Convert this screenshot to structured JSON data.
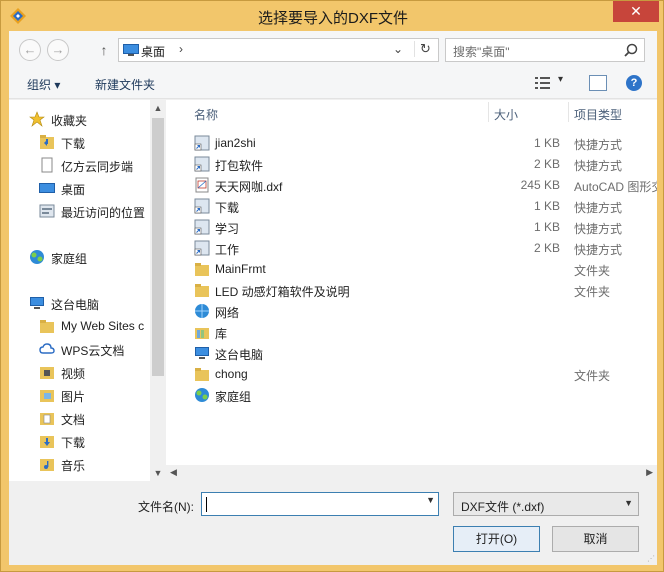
{
  "window": {
    "title": "选择要导入的DXF文件",
    "close_label": "✕"
  },
  "addressbar": {
    "back_label": "←",
    "forward_label": "→",
    "up_label": "↑",
    "path": "桌面",
    "path_sep": "›",
    "path_dropdown": "⌄",
    "refresh_label": "↻",
    "search_placeholder": "搜索\"桌面\""
  },
  "toolbar": {
    "organize_label": "组织 ▾",
    "new_folder_label": "新建文件夹",
    "view_dropdown": "▾",
    "help_label": "?"
  },
  "sidebar": {
    "items": [
      {
        "label": "收藏夹",
        "icon": "star-icon"
      },
      {
        "label": "下载",
        "icon": "download-folder-icon"
      },
      {
        "label": "亿方云同步端",
        "icon": "document-icon"
      },
      {
        "label": "桌面",
        "icon": "desktop-icon"
      },
      {
        "label": "最近访问的位置",
        "icon": "recent-places-icon"
      },
      {
        "label": "家庭组",
        "icon": "homegroup-icon"
      },
      {
        "label": "这台电脑",
        "icon": "computer-icon"
      },
      {
        "label": "My Web Sites c",
        "icon": "folder-icon"
      },
      {
        "label": "WPS云文档",
        "icon": "cloud-icon"
      },
      {
        "label": "视频",
        "icon": "video-folder-icon"
      },
      {
        "label": "图片",
        "icon": "pictures-folder-icon"
      },
      {
        "label": "文档",
        "icon": "documents-folder-icon"
      },
      {
        "label": "下载",
        "icon": "download-folder-icon"
      },
      {
        "label": "音乐",
        "icon": "music-folder-icon"
      }
    ]
  },
  "filelist": {
    "columns": {
      "name": "名称",
      "size": "大小",
      "type": "项目类型"
    },
    "rows": [
      {
        "name": "jian2shi",
        "size": "1 KB",
        "type": "快捷方式",
        "icon": "shortcut-icon"
      },
      {
        "name": "打包软件",
        "size": "2 KB",
        "type": "快捷方式",
        "icon": "shortcut-icon"
      },
      {
        "name": "天天网咖.dxf",
        "size": "245 KB",
        "type": "AutoCAD 图形交",
        "icon": "dxf-file-icon"
      },
      {
        "name": "下载",
        "size": "1 KB",
        "type": "快捷方式",
        "icon": "shortcut-icon"
      },
      {
        "name": "学习",
        "size": "1 KB",
        "type": "快捷方式",
        "icon": "shortcut-icon"
      },
      {
        "name": "工作",
        "size": "2 KB",
        "type": "快捷方式",
        "icon": "shortcut-icon"
      },
      {
        "name": "MainFrmt",
        "size": "",
        "type": "文件夹",
        "icon": "folder-icon"
      },
      {
        "name": "LED 动感灯箱软件及说明",
        "size": "",
        "type": "文件夹",
        "icon": "folder-icon"
      },
      {
        "name": "网络",
        "size": "",
        "type": "",
        "icon": "network-icon"
      },
      {
        "name": "库",
        "size": "",
        "type": "",
        "icon": "library-icon"
      },
      {
        "name": "这台电脑",
        "size": "",
        "type": "",
        "icon": "computer-icon"
      },
      {
        "name": "chong",
        "size": "",
        "type": "文件夹",
        "icon": "folder-icon"
      },
      {
        "name": "家庭组",
        "size": "",
        "type": "",
        "icon": "homegroup-icon"
      }
    ]
  },
  "bottom": {
    "filename_label": "文件名(N):",
    "filename_value": "",
    "filetype_value": "DXF文件 (*.dxf)",
    "open_label": "打开(O)",
    "cancel_label": "取消"
  }
}
